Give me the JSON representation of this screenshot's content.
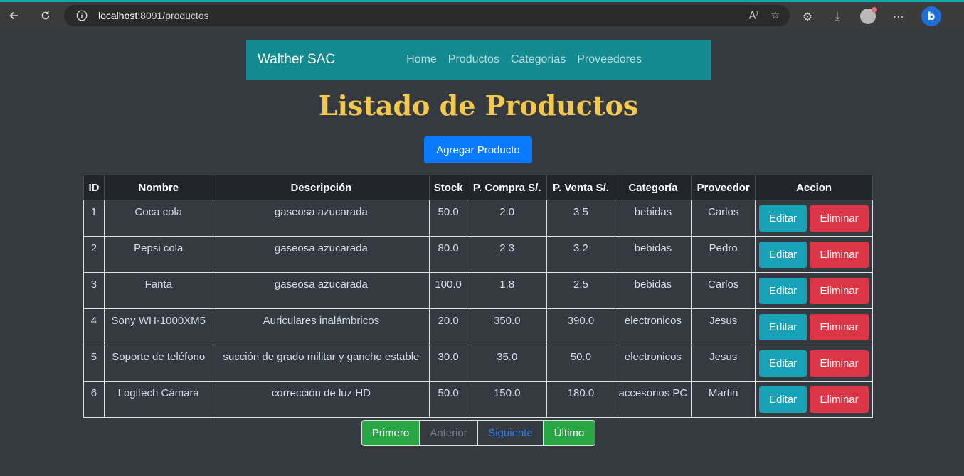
{
  "browser": {
    "url_host": "localhost",
    "url_rest": ":8091/productos",
    "icons": [
      "back-icon",
      "refresh-icon",
      "info-icon",
      "read-aloud-icon",
      "favorite-icon",
      "extensions-icon",
      "download-icon",
      "profile-avatar",
      "more-icon",
      "bing-icon"
    ]
  },
  "navbar": {
    "brand": "Walther SAC",
    "links": [
      "Home",
      "Productos",
      "Categorias",
      "Proveedores"
    ]
  },
  "page": {
    "title": "Listado de Productos",
    "add_button": "Agregar Producto"
  },
  "table": {
    "headers": [
      "ID",
      "Nombre",
      "Descripción",
      "Stock",
      "P. Compra S/.",
      "P. Venta S/.",
      "Categoría",
      "Proveedor",
      "Accion"
    ],
    "rows": [
      {
        "id": "1",
        "nombre": "Coca cola",
        "descripcion": "gaseosa azucarada",
        "stock": "50.0",
        "compra": "2.0",
        "venta": "3.5",
        "categoria": "bebidas",
        "proveedor": "Carlos"
      },
      {
        "id": "2",
        "nombre": "Pepsi cola",
        "descripcion": "gaseosa azucarada",
        "stock": "80.0",
        "compra": "2.3",
        "venta": "3.2",
        "categoria": "bebidas",
        "proveedor": "Pedro"
      },
      {
        "id": "3",
        "nombre": "Fanta",
        "descripcion": "gaseosa azucarada",
        "stock": "100.0",
        "compra": "1.8",
        "venta": "2.5",
        "categoria": "bebidas",
        "proveedor": "Carlos"
      },
      {
        "id": "4",
        "nombre": "Sony WH-1000XM5",
        "descripcion": "Auriculares inalámbricos",
        "stock": "20.0",
        "compra": "350.0",
        "venta": "390.0",
        "categoria": "electronicos",
        "proveedor": "Jesus"
      },
      {
        "id": "5",
        "nombre": "Soporte de teléfono",
        "descripcion": "succión de grado militar y gancho estable",
        "stock": "30.0",
        "compra": "35.0",
        "venta": "50.0",
        "categoria": "electronicos",
        "proveedor": "Jesus"
      },
      {
        "id": "6",
        "nombre": "Logitech Cámara",
        "descripcion": "corrección de luz HD",
        "stock": "50.0",
        "compra": "150.0",
        "venta": "180.0",
        "categoria": "accesorios PC",
        "proveedor": "Martin"
      }
    ],
    "edit_label": "Editar",
    "delete_label": "Eliminar"
  },
  "pagination": {
    "first": "Primero",
    "prev": "Anterior",
    "next": "Siguiente",
    "last": "Último"
  },
  "colors": {
    "navbar": "#138a90",
    "title": "#f4c84a",
    "primary": "#0a7bff",
    "edit": "#17a2b8",
    "delete": "#dc3545",
    "success": "#28a745"
  }
}
